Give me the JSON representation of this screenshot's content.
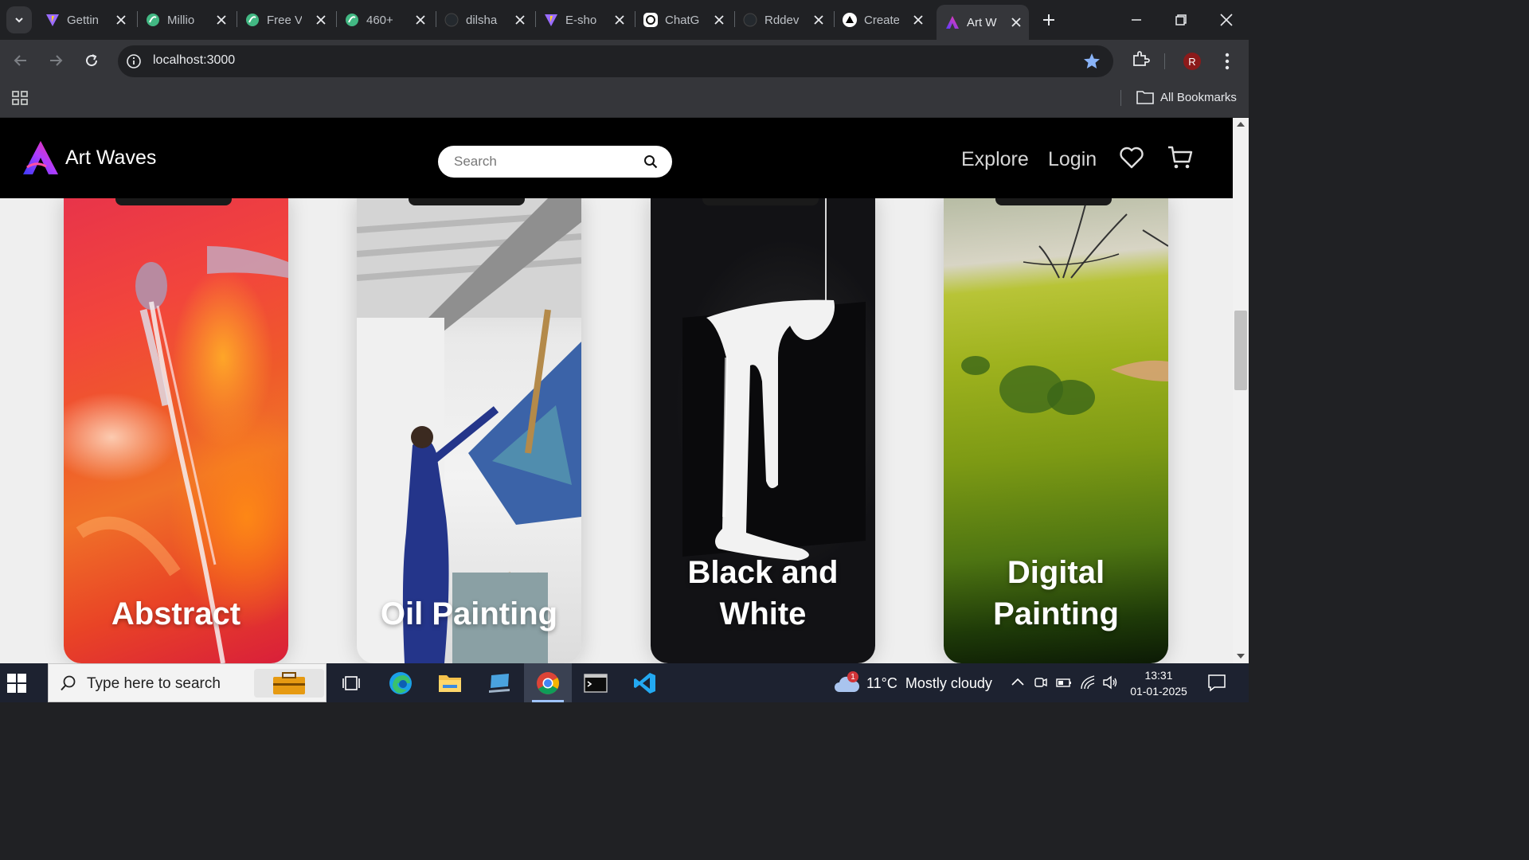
{
  "browser": {
    "tabs": [
      {
        "title": "Gettin",
        "favicon": "vite-icon"
      },
      {
        "title": "Millio",
        "favicon": "green-leaf-icon"
      },
      {
        "title": "Free V",
        "favicon": "green-leaf-icon"
      },
      {
        "title": "460+",
        "favicon": "green-leaf-icon"
      },
      {
        "title": "dilsha",
        "favicon": "github-icon"
      },
      {
        "title": "E-sho",
        "favicon": "vite-icon"
      },
      {
        "title": "ChatG",
        "favicon": "chatgpt-icon"
      },
      {
        "title": "Rddev",
        "favicon": "github-icon"
      },
      {
        "title": "Create",
        "favicon": "nextjs-icon"
      },
      {
        "title": "Art W",
        "favicon": "art-waves-icon",
        "active": true
      }
    ],
    "url": "localhost:3000",
    "profile_initial": "R",
    "bookmarks_label": "All Bookmarks"
  },
  "site": {
    "brand": "Art Waves",
    "search_placeholder": "Search",
    "nav": {
      "explore": "Explore",
      "login": "Login"
    },
    "categories": [
      {
        "line1": "Abstract",
        "line2": ""
      },
      {
        "line1": "Oil Painting",
        "line2": ""
      },
      {
        "line1": "Black and",
        "line2": "White"
      },
      {
        "line1": "Digital",
        "line2": "Painting"
      }
    ]
  },
  "taskbar": {
    "search_placeholder": "Type here to search",
    "weather_temp": "11°C",
    "weather_desc": "Mostly cloudy",
    "weather_badge": "1",
    "time": "13:31",
    "date": "01-01-2025"
  },
  "colors": {
    "page_bg": "#efefef",
    "nav_bg": "#000000",
    "chrome_dark": "#202124",
    "chrome_toolbar": "#35363a",
    "taskbar_bg": "#1d2230"
  }
}
